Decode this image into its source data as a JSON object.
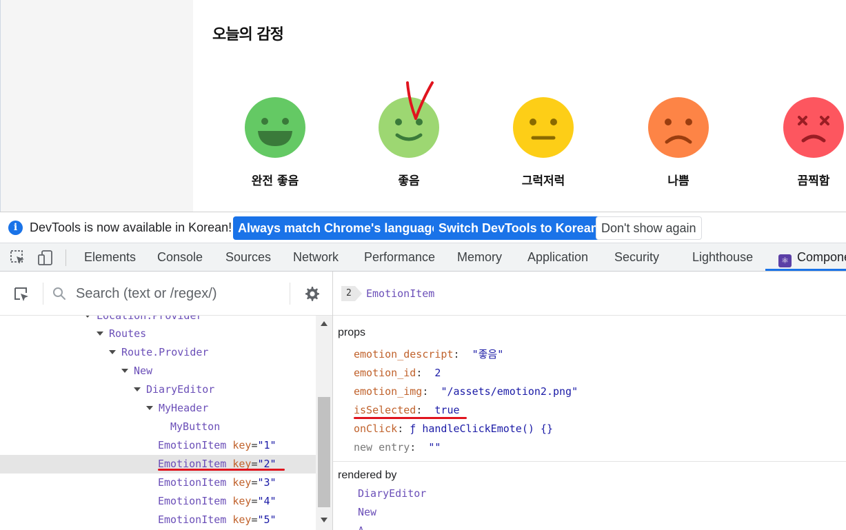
{
  "app": {
    "section_title": "오늘의 감정",
    "emotions": [
      {
        "id": 1,
        "label": "완전 좋음",
        "face": "very-good-face",
        "color": "#64c964"
      },
      {
        "id": 2,
        "label": "좋음",
        "face": "good-face",
        "color": "#9dd772"
      },
      {
        "id": 3,
        "label": "그럭저럭",
        "face": "so-so-face",
        "color": "#fdce17"
      },
      {
        "id": 4,
        "label": "나쁨",
        "face": "bad-face",
        "color": "#fd8446"
      },
      {
        "id": 5,
        "label": "끔찍함",
        "face": "terrible-face",
        "color": "#fd565f"
      }
    ]
  },
  "infobar": {
    "message": "DevTools is now available in Korean!",
    "btn_match": "Always match Chrome's language",
    "btn_switch": "Switch DevTools to Korean",
    "btn_dismiss": "Don't show again"
  },
  "tabs": {
    "elements": "Elements",
    "console": "Console",
    "sources": "Sources",
    "network": "Network",
    "performance": "Performance",
    "memory": "Memory",
    "application": "Application",
    "security": "Security",
    "lighthouse": "Lighthouse",
    "components": "Compone"
  },
  "search": {
    "placeholder": "Search (text or /regex/)"
  },
  "tree": {
    "location_provider": "Location.Provider",
    "routes": "Routes",
    "route_provider": "Route.Provider",
    "new": "New",
    "diary_editor": "DiaryEditor",
    "my_header": "MyHeader",
    "my_button": "MyButton",
    "emotion_items": [
      {
        "name": "EmotionItem",
        "key": "key",
        "value": "\"1\""
      },
      {
        "name": "EmotionItem",
        "key": "key",
        "value": "\"2\""
      },
      {
        "name": "EmotionItem",
        "key": "key",
        "value": "\"3\""
      },
      {
        "name": "EmotionItem",
        "key": "key",
        "value": "\"4\""
      },
      {
        "name": "EmotionItem",
        "key": "key",
        "value": "\"5\""
      }
    ]
  },
  "inspector": {
    "badge": "2",
    "title": "EmotionItem",
    "props_label": "props",
    "props": {
      "emotion_descript_key": "emotion_descript",
      "emotion_descript_val": "\"좋음\"",
      "emotion_id_key": "emotion_id",
      "emotion_id_val": "2",
      "emotion_img_key": "emotion_img",
      "emotion_img_val": "\"/assets/emotion2.png\"",
      "isSelected_key": "isSelected",
      "isSelected_val": "true",
      "onClick_key": "onClick",
      "onClick_val": "ƒ handleClickEmote() {}",
      "new_entry_key": "new entry",
      "new_entry_val": "\"\""
    },
    "rendered_by_label": "rendered by",
    "rendered_by": [
      "DiaryEditor",
      "New",
      "A"
    ]
  },
  "colors": {
    "devtools_blue": "#1a73e8",
    "component_purple": "#6b4fb8",
    "prop_key_orange": "#c0622c",
    "annotation_red": "#e0141e"
  }
}
